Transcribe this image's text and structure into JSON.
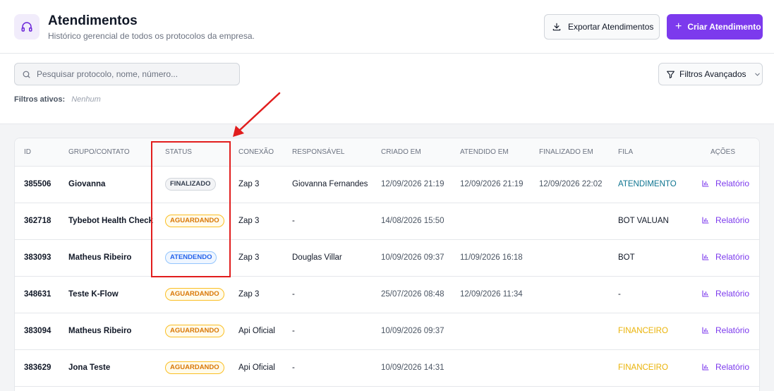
{
  "header": {
    "title": "Atendimentos",
    "subtitle": "Histórico gerencial de todos os protocolos da empresa.",
    "export_label": "Exportar Atendimentos",
    "create_label": "Criar Atendimento",
    "logo_icon": "headset-icon",
    "accent_color": "#7c3aed"
  },
  "filters": {
    "search_placeholder": "Pesquisar protocolo, nome, número...",
    "search_value": "",
    "advanced_label": "Filtros Avançados",
    "active_label": "Filtros ativos:",
    "active_value": "Nenhum"
  },
  "table": {
    "columns": [
      "ID",
      "GRUPO/CONTATO",
      "STATUS",
      "CONEXÃO",
      "RESPONSÁVEL",
      "CRIADO EM",
      "ATENDIDO EM",
      "FINALIZADO EM",
      "FILA",
      "AÇÕES"
    ],
    "action_label": "Relatório",
    "rows": [
      {
        "id": "385506",
        "contact": "Giovanna",
        "status": "FINALIZADO",
        "status_key": "finalizado",
        "connection": "Zap 3",
        "responsible": "Giovanna Fernandes",
        "created": "12/09/2026 21:19",
        "attended": "12/09/2026 21:19",
        "finished": "12/09/2026 22:02",
        "queue": "ATENDIMENTO",
        "queue_color": "#0e7490"
      },
      {
        "id": "362718",
        "contact": "Tybebot Health Check",
        "status": "AGUARDANDO",
        "status_key": "aguardando",
        "connection": "Zap 3",
        "responsible": "-",
        "created": "14/08/2026 15:50",
        "attended": "",
        "finished": "",
        "queue": "BOT VALUAN",
        "queue_color": "#111827"
      },
      {
        "id": "383093",
        "contact": "Matheus Ribeiro",
        "status": "ATENDENDO",
        "status_key": "atendendo",
        "connection": "Zap 3",
        "responsible": "Douglas Villar",
        "created": "10/09/2026 09:37",
        "attended": "11/09/2026 16:18",
        "finished": "",
        "queue": "BOT",
        "queue_color": "#111827"
      },
      {
        "id": "348631",
        "contact": "Teste K-Flow",
        "status": "AGUARDANDO",
        "status_key": "aguardando",
        "connection": "Zap 3",
        "responsible": "-",
        "created": "25/07/2026 08:48",
        "attended": "12/09/2026 11:34",
        "finished": "",
        "queue": "-",
        "queue_color": "#111827"
      },
      {
        "id": "383094",
        "contact": "Matheus Ribeiro",
        "status": "AGUARDANDO",
        "status_key": "aguardando",
        "connection": "Api Oficial",
        "responsible": "-",
        "created": "10/09/2026 09:37",
        "attended": "",
        "finished": "",
        "queue": "FINANCEIRO",
        "queue_color": "#eab308"
      },
      {
        "id": "383629",
        "contact": "Jona Teste",
        "status": "AGUARDANDO",
        "status_key": "aguardando",
        "connection": "Api Oficial",
        "responsible": "-",
        "created": "10/09/2026 14:31",
        "attended": "",
        "finished": "",
        "queue": "FINANCEIRO",
        "queue_color": "#eab308"
      }
    ]
  },
  "annotation": {
    "highlight_color": "#e11d1d"
  }
}
